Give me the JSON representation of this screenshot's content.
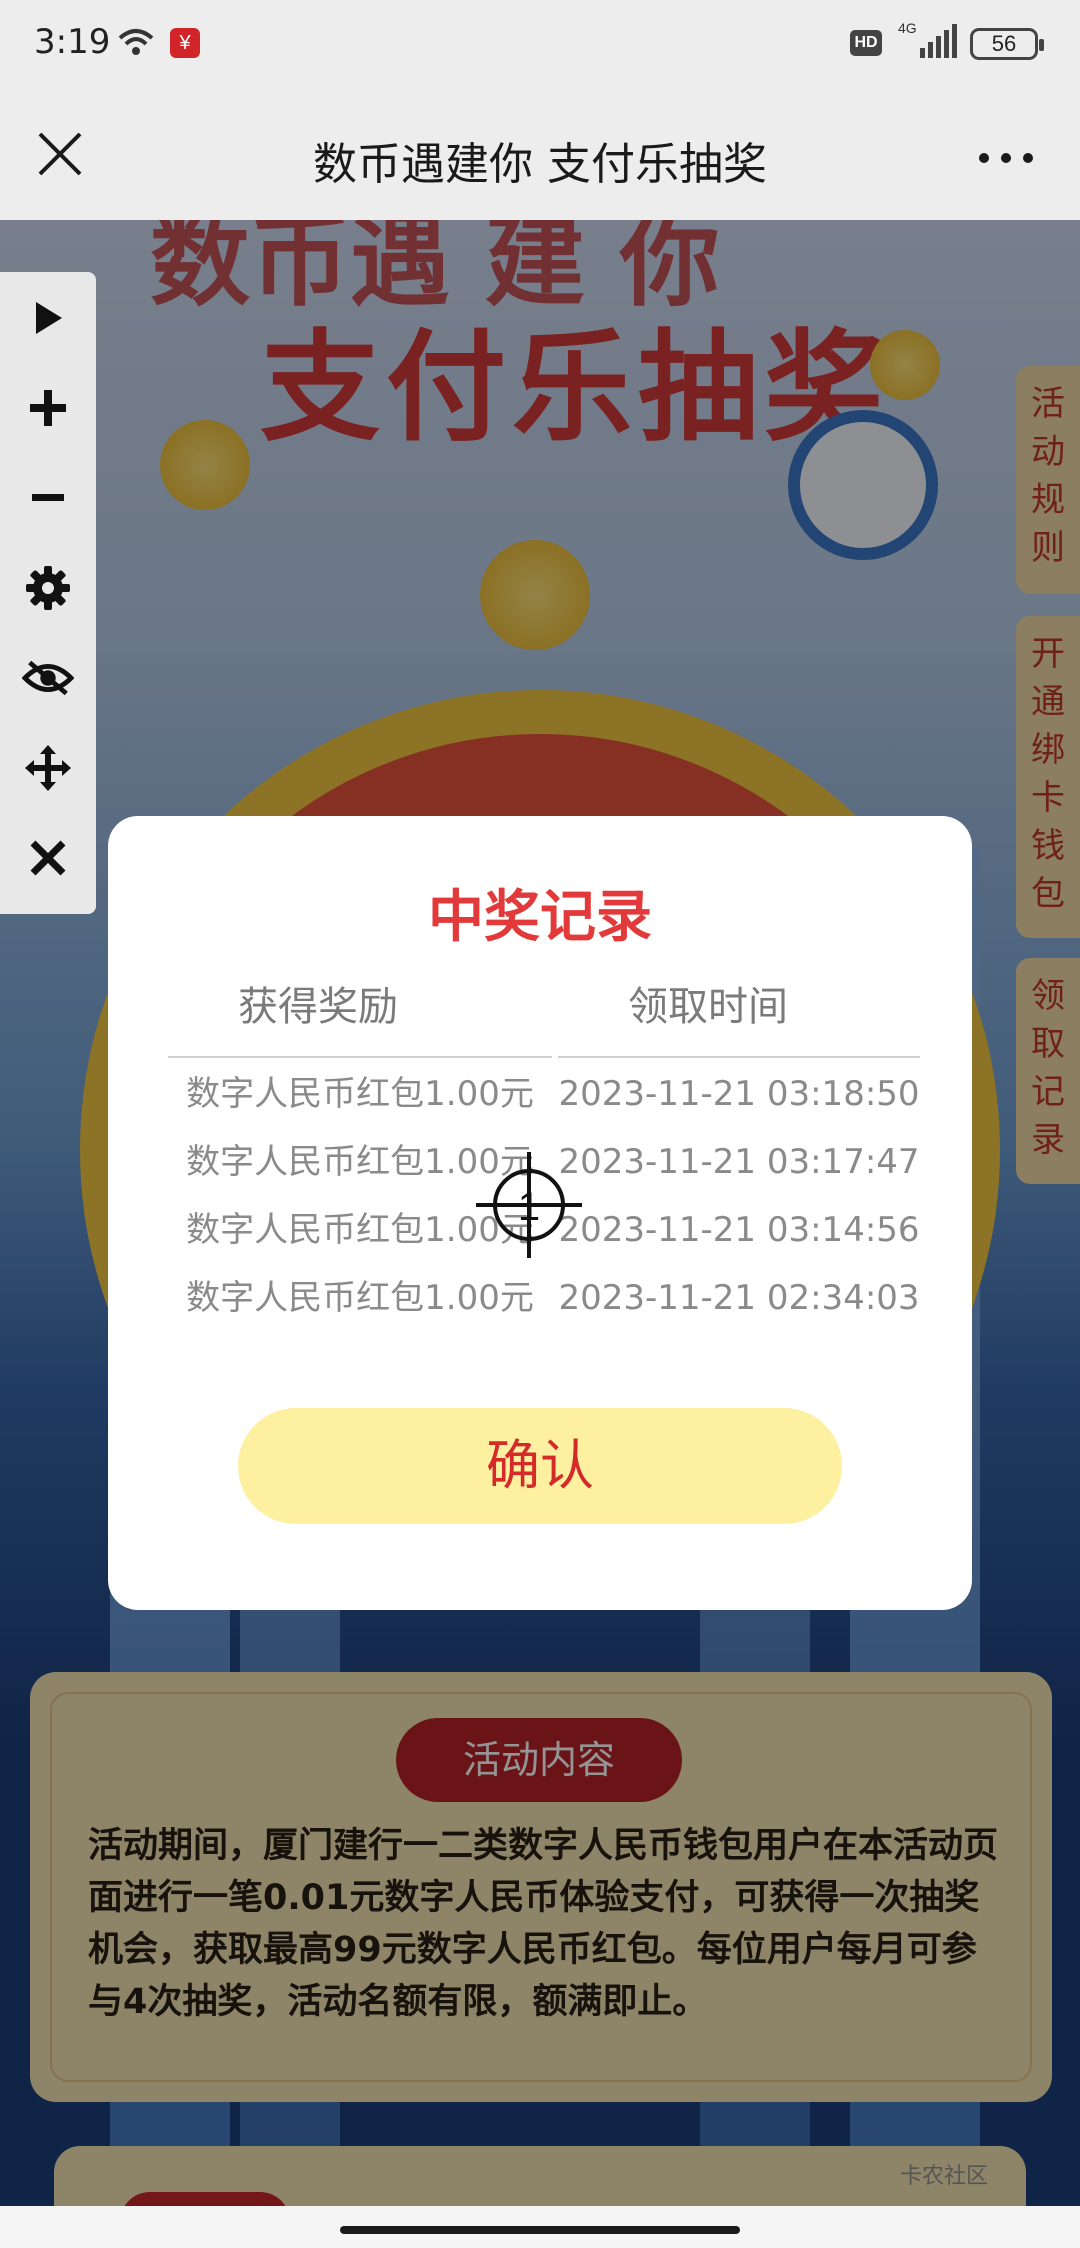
{
  "status_bar": {
    "time": "3:19",
    "hd_badge": "HD",
    "network": "4G",
    "battery": "56"
  },
  "title_bar": {
    "title": "数币遇建你 支付乐抽奖"
  },
  "hero": {
    "title_top": "数币遇 建 你",
    "title": "支付乐抽奖"
  },
  "side_tabs": [
    {
      "label": "活动规则"
    },
    {
      "label": "开通绑卡钱包"
    },
    {
      "label": "领取记录"
    }
  ],
  "floating_toolbar": {
    "buttons": [
      {
        "icon": "play-icon"
      },
      {
        "icon": "plus-icon"
      },
      {
        "icon": "minus-icon"
      },
      {
        "icon": "gear-icon"
      },
      {
        "icon": "eye-off-icon"
      },
      {
        "icon": "move-icon"
      },
      {
        "icon": "close-icon"
      }
    ]
  },
  "dialog": {
    "title": "中奖记录",
    "columns": [
      "获得奖励",
      "领取时间"
    ],
    "rows": [
      {
        "reward": "数字人民币红包1.00元",
        "time": "2023-11-21 03:18:50"
      },
      {
        "reward": "数字人民币红包1.00元",
        "time": "2023-11-21 03:17:47"
      },
      {
        "reward": "数字人民币红包1.00元",
        "time": "2023-11-21 03:14:56"
      },
      {
        "reward": "数字人民币红包1.00元",
        "time": "2023-11-21 02:34:03"
      }
    ],
    "confirm_label": "确认"
  },
  "crosshair": {
    "label": "1"
  },
  "activity": {
    "pill_label": "活动内容",
    "text": "活动期间，厦门建行一二类数字人民币钱包用户在本活动页面进行一笔0.01元数字人民币体验支付，可获得一次抽奖机会，获取最高99元数字人民币红包。每位用户每月可参与4次抽奖，活动名额有限，额满即止。"
  },
  "watermark": "卡农社区",
  "colors": {
    "accent_red": "#e23a3a",
    "confirm_bg": "#fdf0a0",
    "pill_red": "#b9242a"
  }
}
